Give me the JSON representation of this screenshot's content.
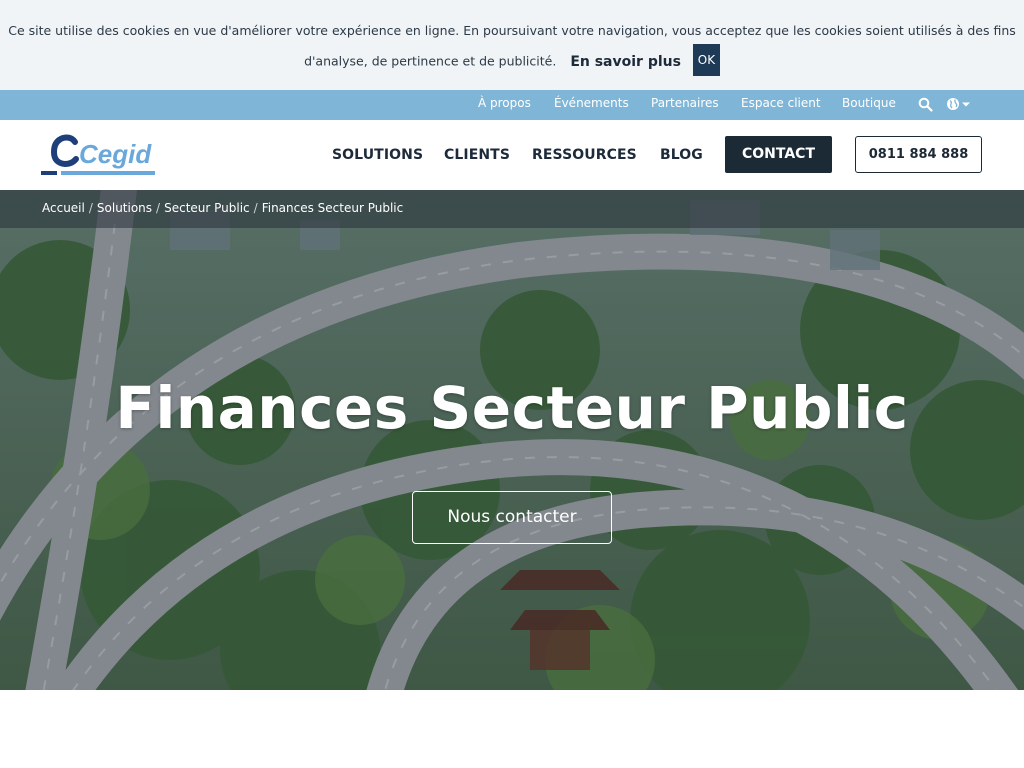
{
  "cookie_banner": {
    "message": "Ce site utilise des cookies en vue d'améliorer votre expérience en ligne. En poursuivant votre navigation, vous acceptez que les cookies soient utilisés à des fins d'analyse, de pertinence et de publicité.",
    "learn_more": "En savoir plus",
    "ok": "OK"
  },
  "utility_nav": {
    "links": [
      "À propos",
      "Événements",
      "Partenaires",
      "Espace client",
      "Boutique"
    ],
    "search_icon": "search-icon",
    "language_icon": "globe-icon"
  },
  "header": {
    "logo_text": "Cegid",
    "nav": [
      "SOLUTIONS",
      "CLIENTS",
      "RESSOURCES",
      "BLOG"
    ],
    "contact": "CONTACT",
    "phone": "0811 884 888"
  },
  "breadcrumb": [
    "Accueil",
    "Solutions",
    "Secteur Public",
    "Finances Secteur Public"
  ],
  "hero": {
    "title": "Finances Secteur Public",
    "cta": "Nous contacter"
  },
  "colors": {
    "utility_bar": "#7fb6d8",
    "dark_navy": "#1c2a36",
    "logo_blue": "#1e3f7a",
    "logo_light_blue": "#6aa8dc"
  }
}
